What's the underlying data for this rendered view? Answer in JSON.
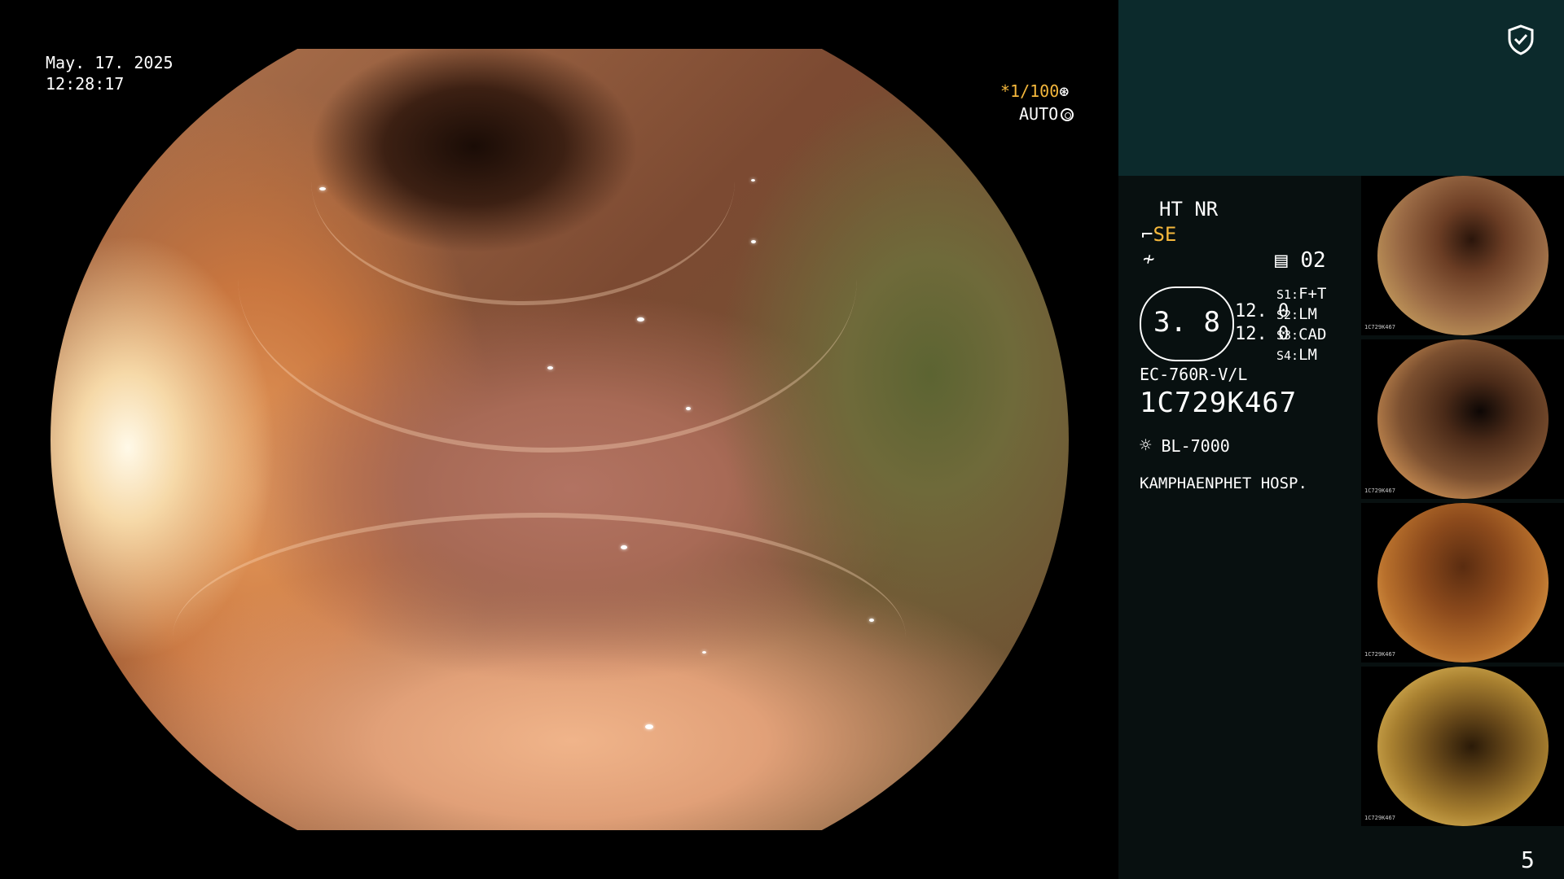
{
  "overlay": {
    "date": "May. 17. 2025",
    "time": "12:28:17",
    "shutter": "*1/100",
    "iris_mode": "AUTO"
  },
  "panel": {
    "mode_line": "HT NR",
    "se_label": "SE",
    "memory_slot": "02",
    "gauge_value": "3. 8",
    "gauge_left": [
      "12. 0",
      "12. 0"
    ],
    "presets": [
      {
        "key": "S1:",
        "val": "F+T"
      },
      {
        "key": "S2:",
        "val": "LM"
      },
      {
        "key": "S3:",
        "val": "CAD"
      },
      {
        "key": "S4:",
        "val": "LM"
      }
    ],
    "scope_model": "EC-760R-V/L",
    "scope_serial": "1C729K467",
    "light_source": "BL-7000",
    "hospital": "KAMPHAENPHET HOSP.",
    "page_number": "5"
  },
  "thumbnails": [
    {
      "label": "1C729K467"
    },
    {
      "label": "1C729K467"
    },
    {
      "label": "1C729K467"
    },
    {
      "label": "1C729K467"
    }
  ],
  "icons": {
    "shield": "shield-check-icon",
    "iris": "iris-icon",
    "structure": "structure-enhance-icon",
    "freeze": "freeze-icon",
    "memory": "memory-icon",
    "lamp": "lamp-icon"
  }
}
